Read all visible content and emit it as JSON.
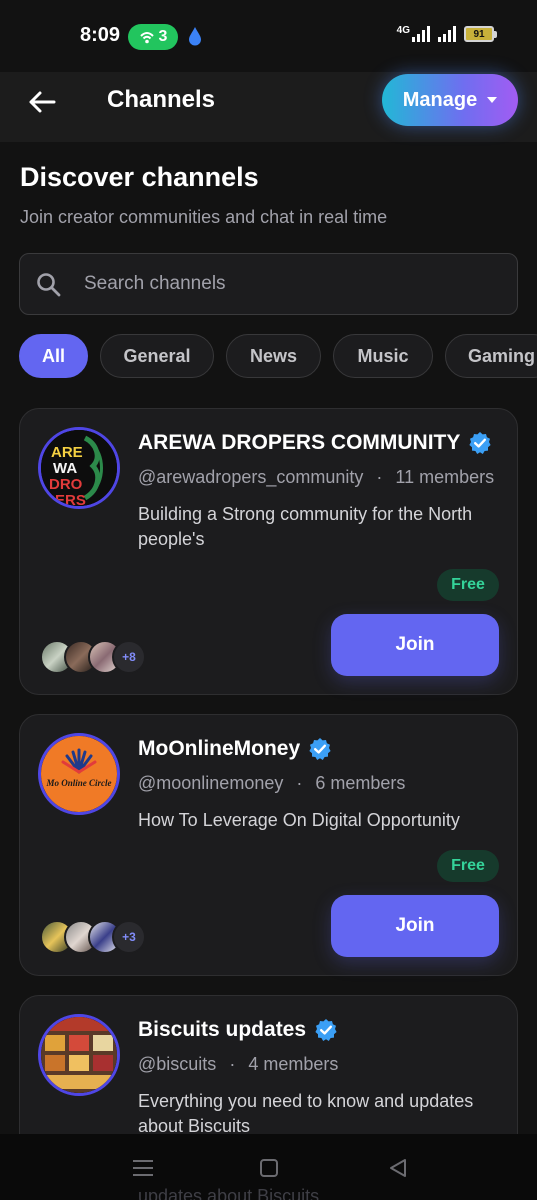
{
  "status_bar": {
    "time": "8:09",
    "hotspot_count": "3",
    "network": "4G",
    "battery": "91"
  },
  "header": {
    "title": "Channels",
    "manage_label": "Manage"
  },
  "hero": {
    "title": "Discover channels",
    "subtitle": "Join creator communities and chat in real time"
  },
  "search": {
    "placeholder": "Search channels",
    "value": ""
  },
  "filters": {
    "selected": "All",
    "items": [
      "All",
      "General",
      "News",
      "Music",
      "Gaming"
    ]
  },
  "channels": [
    {
      "name": "AREWA DROPERS COMMUNITY",
      "handle": "@arewadropers_community",
      "members": "11 members",
      "description": "Building a Strong community for the North people's",
      "avatar_text": [
        "ARE",
        "WA",
        "DRO",
        "PERS"
      ],
      "price_badge": "Free",
      "join_label": "Join",
      "extra_members": "+8"
    },
    {
      "name": "MoOnlineMoney",
      "handle": "@moonlinemoney",
      "members": "6 members",
      "description": "How To Leverage On Digital Opportunity",
      "avatar_text": [
        "Mo Online Circle"
      ],
      "price_badge": "Free",
      "join_label": "Join",
      "extra_members": "+3"
    },
    {
      "name": "Biscuits updates",
      "handle": "@biscuits",
      "members": "4 members",
      "description": "Everything you need to know and updates about Biscuits"
    }
  ],
  "nav_ghost_text": "updates about Biscuits",
  "colors": {
    "accent": "#6366f1",
    "verified": "#3b9ff5",
    "free_text": "#34d399",
    "background": "#121212",
    "card": "#1c1c1e"
  },
  "icons": {
    "back": "arrow-left-icon",
    "manage_caret": "caret-down-icon",
    "search": "search-icon",
    "verified": "verified-badge-icon",
    "nav_menu": "menu-icon",
    "nav_home": "square-icon",
    "nav_back": "triangle-back-icon"
  }
}
